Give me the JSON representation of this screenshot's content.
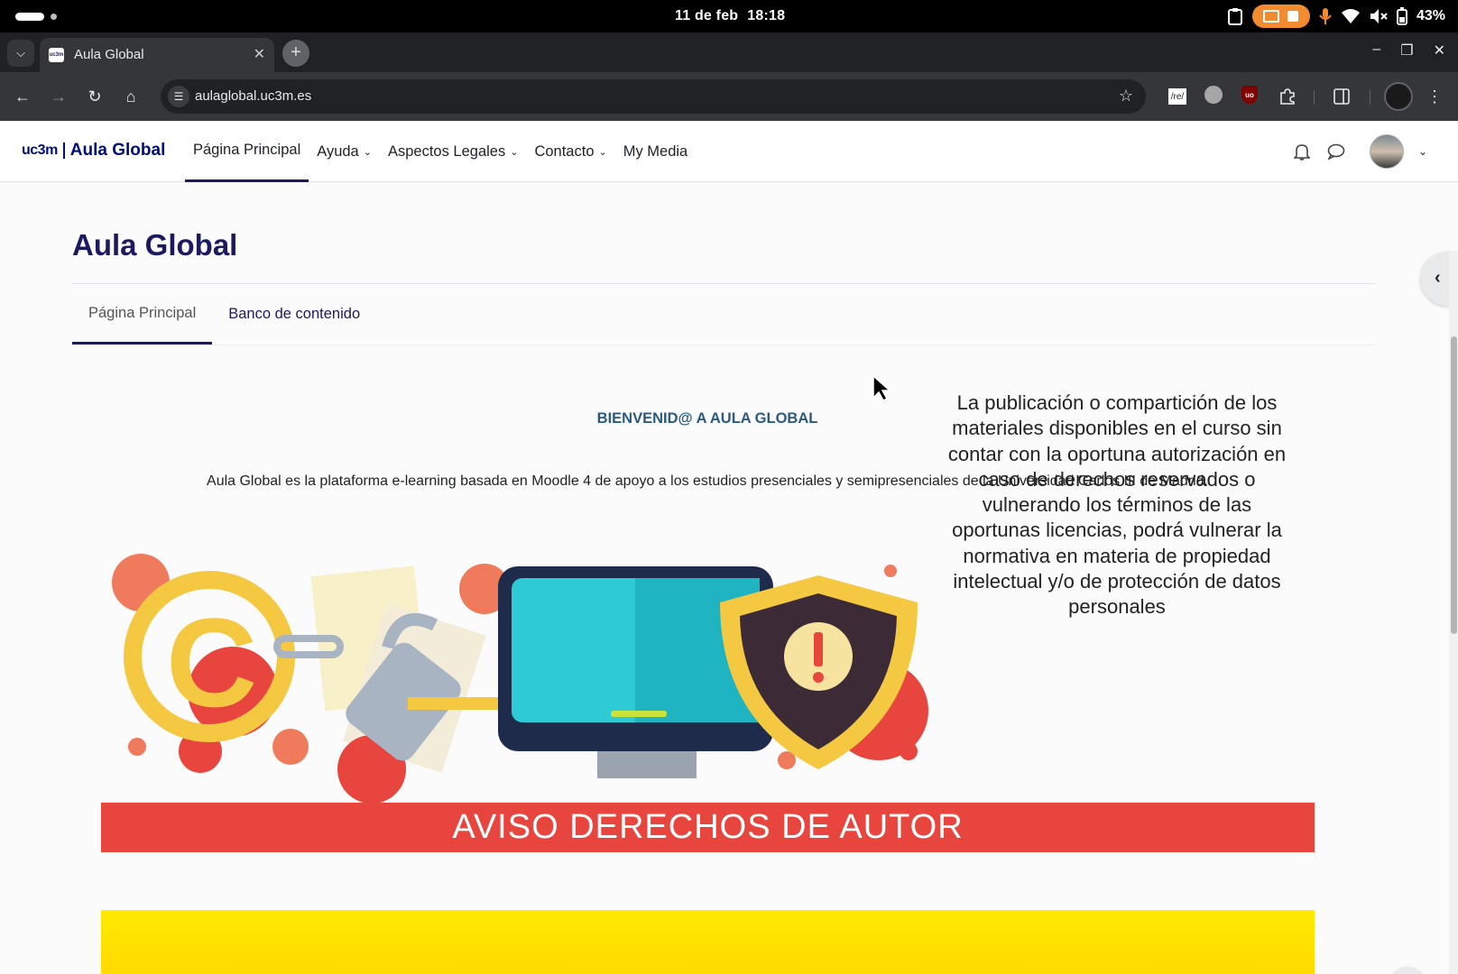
{
  "os": {
    "date": "11 de feb",
    "time": "18:18",
    "battery": "43%"
  },
  "browser": {
    "tab_title": "Aula Global",
    "favicon_text": "uc3m",
    "url": "aulaglobal.uc3m.es",
    "ext_re_label": "/re/",
    "ext_ub_label": "uo"
  },
  "site": {
    "logo_uc3m": "uc3m",
    "logo_name": "Aula Global",
    "nav": {
      "home": "Página Principal",
      "help": "Ayuda",
      "legal": "Aspectos Legales",
      "contact": "Contacto",
      "media": "My Media"
    }
  },
  "page": {
    "heading": "Aula Global",
    "tabs": {
      "main": "Página Principal",
      "content_bank": "Banco de contenido"
    },
    "welcome": "BIENVENID@ A AULA GLOBAL",
    "intro": "Aula Global es la plataforma e-learning basada en Moodle 4 de apoyo a los estudios presenciales y semipresenciales de la Universidad Carlos III de Madrid.",
    "banner_text": "La publicación o compartición de los materiales disponibles en el curso sin contar con la oportuna autorización en caso de derechos reservados o vulnerando los términos de las oportunas licencias, podrá vulnerar la normativa en materia de propiedad intelectual y/o de protección de datos personales",
    "banner_title": "AVISO DERECHOS DE AUTOR",
    "help_label": "?"
  },
  "colors": {
    "brand": "#1b1a5e",
    "welcome": "#2b5a80",
    "aviso_red": "#e8453f",
    "chrome_dark": "#202124",
    "chrome_toolbar": "#35363a"
  }
}
